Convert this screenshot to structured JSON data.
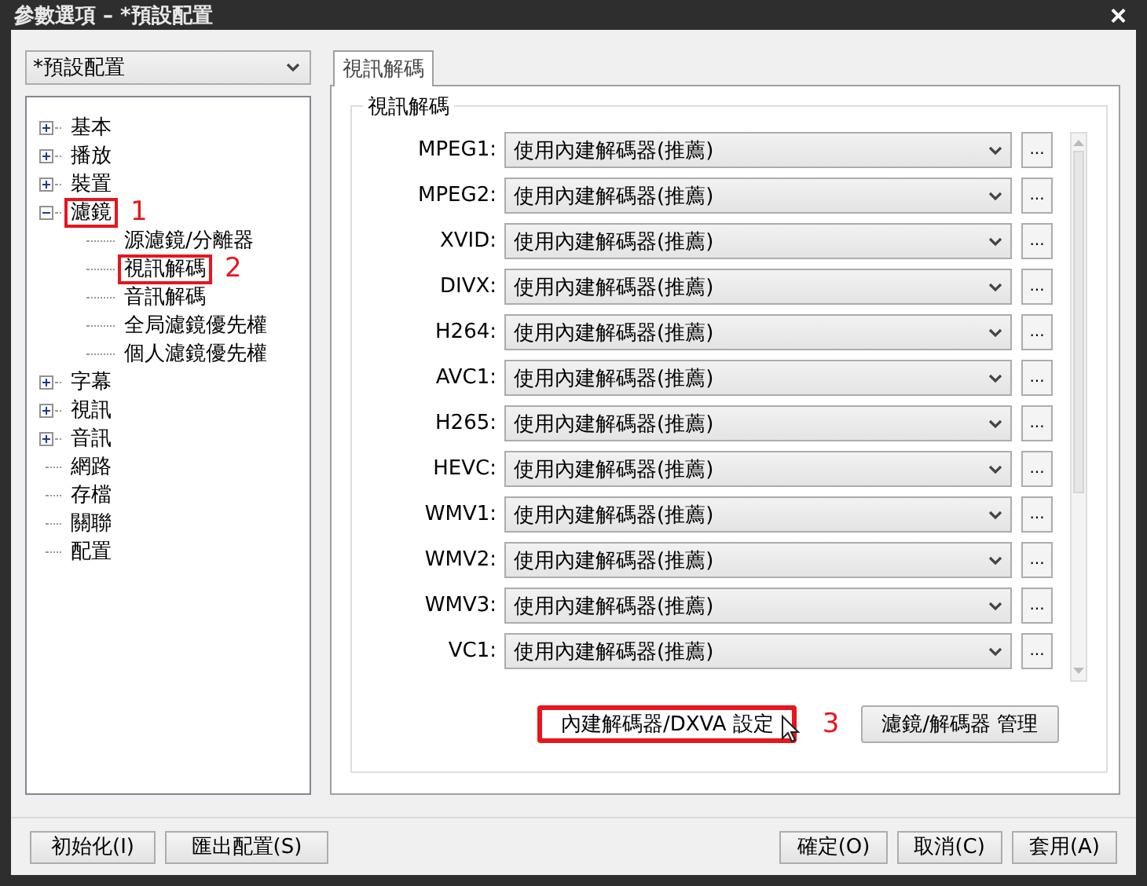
{
  "window": {
    "title": "參數選項 – *預設配置",
    "close": "×"
  },
  "profile": {
    "value": "*預設配置"
  },
  "tree": [
    {
      "label": "基本",
      "expanded": false
    },
    {
      "label": "播放",
      "expanded": false
    },
    {
      "label": "裝置",
      "expanded": false
    },
    {
      "label": "濾鏡",
      "expanded": true,
      "annotation": "1",
      "children": [
        {
          "label": "源濾鏡/分離器"
        },
        {
          "label": "視訊解碼",
          "annotation": "2"
        },
        {
          "label": "音訊解碼"
        },
        {
          "label": "全局濾鏡優先權"
        },
        {
          "label": "個人濾鏡優先權"
        }
      ]
    },
    {
      "label": "字幕",
      "expanded": false
    },
    {
      "label": "視訊",
      "expanded": false
    },
    {
      "label": "音訊",
      "expanded": false
    },
    {
      "label": "網路"
    },
    {
      "label": "存檔"
    },
    {
      "label": "關聯"
    },
    {
      "label": "配置"
    }
  ],
  "tabs": [
    {
      "label": "視訊解碼",
      "selected": true
    }
  ],
  "group": {
    "title": "視訊解碼",
    "rows": [
      {
        "label": "MPEG1:",
        "value": "使用內建解碼器(推薦)",
        "more": "..."
      },
      {
        "label": "MPEG2:",
        "value": "使用內建解碼器(推薦)",
        "more": "..."
      },
      {
        "label": "XVID:",
        "value": "使用內建解碼器(推薦)",
        "more": "..."
      },
      {
        "label": "DIVX:",
        "value": "使用內建解碼器(推薦)",
        "more": "..."
      },
      {
        "label": "H264:",
        "value": "使用內建解碼器(推薦)",
        "more": "..."
      },
      {
        "label": "AVC1:",
        "value": "使用內建解碼器(推薦)",
        "more": "..."
      },
      {
        "label": "H265:",
        "value": "使用內建解碼器(推薦)",
        "more": "..."
      },
      {
        "label": "HEVC:",
        "value": "使用內建解碼器(推薦)",
        "more": "..."
      },
      {
        "label": "WMV1:",
        "value": "使用內建解碼器(推薦)",
        "more": "..."
      },
      {
        "label": "WMV2:",
        "value": "使用內建解碼器(推薦)",
        "more": "..."
      },
      {
        "label": "WMV3:",
        "value": "使用內建解碼器(推薦)",
        "more": "..."
      },
      {
        "label": "VC1:",
        "value": "使用內建解碼器(推薦)",
        "more": "..."
      }
    ],
    "buttons": [
      {
        "label": "內建解碼器/DXVA 設定",
        "annotation": "3"
      },
      {
        "label": "濾鏡/解碼器 管理"
      }
    ]
  },
  "footer": {
    "left": [
      "初始化(I)",
      "匯出配置(S)"
    ],
    "right": [
      "確定(O)",
      "取消(C)",
      "套用(A)"
    ]
  }
}
